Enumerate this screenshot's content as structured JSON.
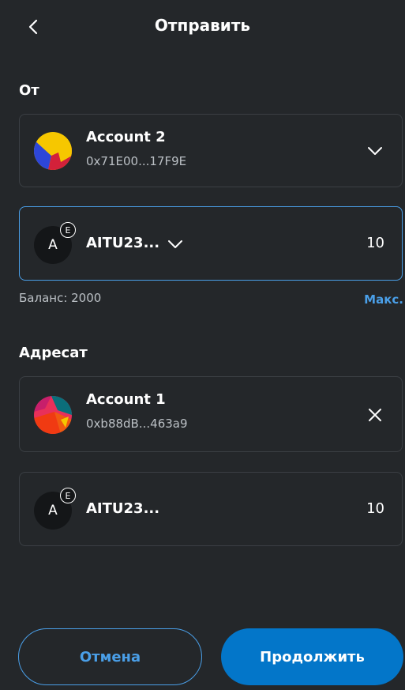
{
  "header": {
    "title": "Отправить",
    "back_icon": "chevron-left-icon"
  },
  "from": {
    "label": "От",
    "account": {
      "name": "Account 2",
      "address": "0x71E00...17F9E",
      "dropdown_icon": "chevron-down-icon"
    },
    "token": {
      "icon_letter": "A",
      "network_badge": "E",
      "name": "AITU23...",
      "amount": "10",
      "dropdown_icon": "chevron-down-icon"
    },
    "balance": "Баланс: 2000",
    "max_label": "Макс."
  },
  "to": {
    "label": "Адресат",
    "account": {
      "name": "Account 1",
      "address": "0xb88dB...463a9",
      "clear_icon": "close-icon"
    },
    "token": {
      "icon_letter": "A",
      "network_badge": "E",
      "name": "AITU23...",
      "amount": "10"
    }
  },
  "footer": {
    "cancel_label": "Отмена",
    "continue_label": "Продолжить"
  },
  "colors": {
    "background": "#24272a",
    "accent": "#4a9fe8",
    "primary_button": "#0376c9",
    "border": "#3b3f44",
    "muted_text": "#bbc0c5"
  }
}
